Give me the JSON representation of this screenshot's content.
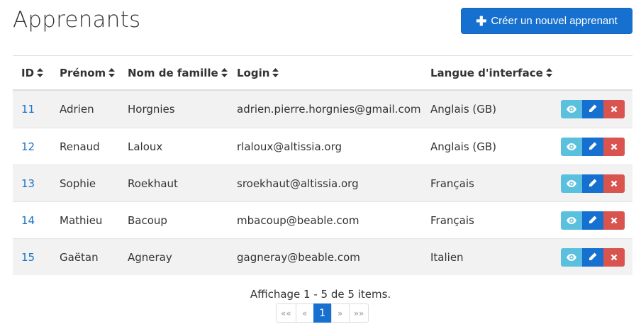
{
  "page": {
    "title": "Apprenants"
  },
  "toolbar": {
    "create_label": "Créer un nouvel apprenant"
  },
  "table": {
    "headers": {
      "id": "ID",
      "first_name": "Prénom",
      "last_name": "Nom de famille",
      "login": "Login",
      "language": "Langue d'interface"
    },
    "rows": [
      {
        "id": "11",
        "first_name": "Adrien",
        "last_name": "Horgnies",
        "login": "adrien.pierre.horgnies@gmail.com",
        "language": "Anglais (GB)"
      },
      {
        "id": "12",
        "first_name": "Renaud",
        "last_name": "Laloux",
        "login": "rlaloux@altissia.org",
        "language": "Anglais (GB)"
      },
      {
        "id": "13",
        "first_name": "Sophie",
        "last_name": "Roekhaut",
        "login": "sroekhaut@altissia.org",
        "language": "Français"
      },
      {
        "id": "14",
        "first_name": "Mathieu",
        "last_name": "Bacoup",
        "login": "mbacoup@beable.com",
        "language": "Français"
      },
      {
        "id": "15",
        "first_name": "Gaëtan",
        "last_name": "Agneray",
        "login": "gagneray@beable.com",
        "language": "Italien"
      }
    ],
    "row_actions": [
      "eye-icon",
      "pencil-icon",
      "close-icon"
    ]
  },
  "summary": "Affichage 1 - 5 de 5 items.",
  "pagination": {
    "first": "««",
    "prev": "«",
    "current": "1",
    "next": "»",
    "last": "»»"
  },
  "colors": {
    "primary": "#1670d0",
    "info": "#5bc0de",
    "danger": "#d9534f",
    "stripe": "#f2f2f2"
  }
}
